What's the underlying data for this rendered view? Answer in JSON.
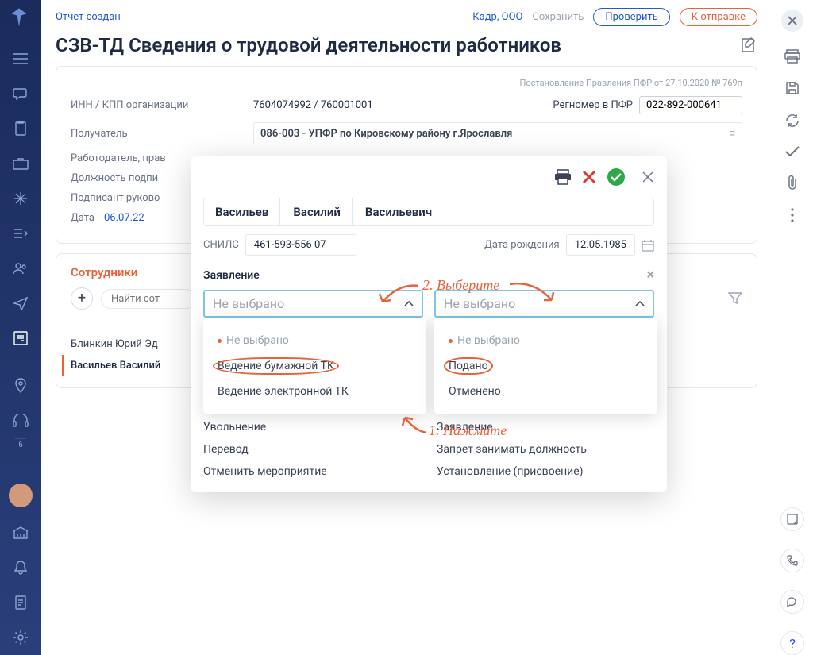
{
  "topbar": {
    "status": "Отчет создан",
    "org": "Кадр, ООО",
    "save": "Сохранить",
    "check": "Проверить",
    "send": "К отправке"
  },
  "page_title": "СЗВ-ТД Сведения о трудовой деятельности работников",
  "meta_note": "Постановление Правления ПФР от 27.10.2020 № 769п",
  "form": {
    "inn_label": "ИНН / КПП организации",
    "inn_value": "7604074992 / 760001001",
    "reg_label": "Регномер в ПФР",
    "reg_value": "022-892-000641",
    "recipient_label": "Получатель",
    "recipient_value": "086-003 - УПФР по Кировскому району г.Ярославля",
    "employer_label": "Работодатель, прав",
    "sign_pos_label": "Должность подпи",
    "sign_head_label": "Подписант руково",
    "date_label": "Дата",
    "date_value": "06.07.22"
  },
  "employees": {
    "heading": "Сотрудники",
    "search_placeholder": "Найти сот",
    "list": [
      {
        "name": "Блинкин Юрий Эд"
      },
      {
        "name": "Васильев Василий"
      }
    ]
  },
  "modal": {
    "surname": "Васильев",
    "first": "Василий",
    "patronymic": "Васильевич",
    "snils_label": "СНИЛС",
    "snils": "461-593-556 07",
    "dob_label": "Дата рождения",
    "dob": "12.05.1985",
    "section": "Заявление",
    "dropdown_placeholder": "Не выбрано",
    "options_left": [
      "Не выбрано",
      "Ведение бумажной ТК",
      "Ведение электронной ТК"
    ],
    "options_right": [
      "Не выбрано",
      "Подано",
      "Отменено"
    ],
    "actions_col1": [
      "Увольнение",
      "Перевод",
      "Отменить мероприятие"
    ],
    "actions_col2": [
      "Заявление",
      "Запрет занимать должность",
      "Установление (присвоение)"
    ]
  },
  "annotations": {
    "step1": "1. Нажмите",
    "step2": "2. Выберите"
  },
  "sidebar_badge": "6"
}
